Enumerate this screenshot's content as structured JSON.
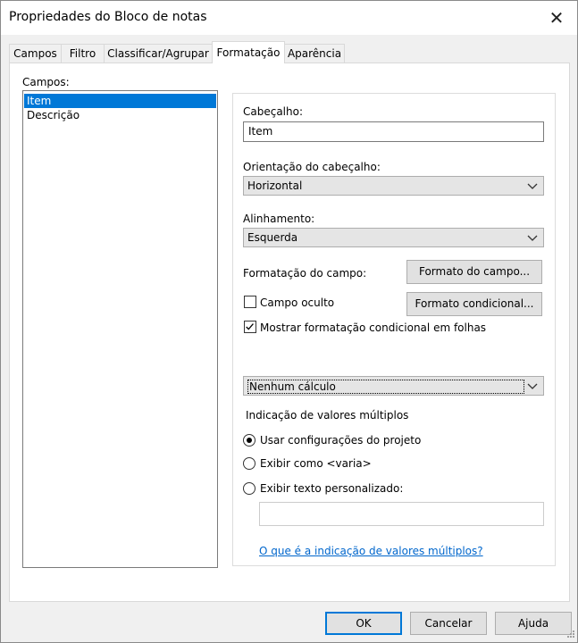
{
  "window": {
    "title": "Propriedades do Bloco de notas",
    "close_glyph": "✕"
  },
  "tabs": [
    {
      "label": "Campos"
    },
    {
      "label": "Filtro"
    },
    {
      "label": "Classificar/Agrupar"
    },
    {
      "label": "Formatação",
      "active": true
    },
    {
      "label": "Aparência"
    }
  ],
  "fields_panel": {
    "label": "Campos:",
    "items": [
      "Item",
      "Descrição"
    ],
    "selected": "Item"
  },
  "format": {
    "header_label": "Cabeçalho:",
    "header_value": "Item",
    "orientation_label": "Orientação do cabeçalho:",
    "orientation_value": "Horizontal",
    "alignment_label": "Alinhamento:",
    "alignment_value": "Esquerda",
    "field_format_label": "Formatação do campo:",
    "field_format_button": "Formato do campo...",
    "hidden_field_label": "Campo oculto",
    "hidden_field_checked": false,
    "conditional_format_button": "Formato condicional...",
    "show_conditional_label": "Mostrar formatação condicional em folhas",
    "show_conditional_checked": true,
    "calculation_value": "Nenhum cálculo",
    "multi_values_heading": "Indicação de valores múltiplos",
    "radio_project": "Usar configurações do projeto",
    "radio_varies": "Exibir como <varia>",
    "radio_custom": "Exibir texto personalizado:",
    "custom_text_value": "",
    "help_link": "O que é a indicação de valores múltiplos?"
  },
  "footer": {
    "ok": "OK",
    "cancel": "Cancelar",
    "help": "Ajuda"
  },
  "icons": {
    "dropdown": "chevron-down-icon",
    "check": "checkmark-icon",
    "close": "close-icon",
    "grip": "resize-grip-icon"
  }
}
